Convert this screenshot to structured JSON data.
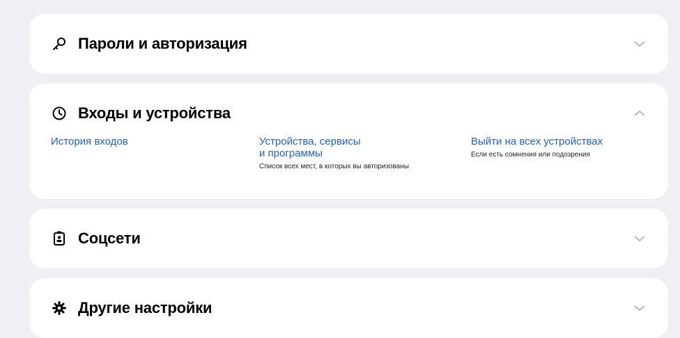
{
  "sections": [
    {
      "title": "Пароли и авторизация",
      "icon": "key-icon",
      "expanded": false
    },
    {
      "title": "Входы и устройства",
      "icon": "clock-icon",
      "expanded": true,
      "links": [
        {
          "label": "История входов",
          "description": ""
        },
        {
          "label_line1": "Устройства, сервисы",
          "label_line2": "и программы",
          "description": "Список всех мест, в которых вы авторизованы"
        },
        {
          "label": "Выйти на всех устройствах",
          "description": "Если есть сомнения или подозрения"
        }
      ]
    },
    {
      "title": "Соцсети",
      "icon": "id-badge-icon",
      "expanded": false
    },
    {
      "title": "Другие настройки",
      "icon": "gear-icon",
      "expanded": false
    }
  ],
  "colors": {
    "background": "#f0f0f4",
    "card": "#ffffff",
    "link": "#1f5fd6",
    "chevron": "#b8b8c0"
  }
}
